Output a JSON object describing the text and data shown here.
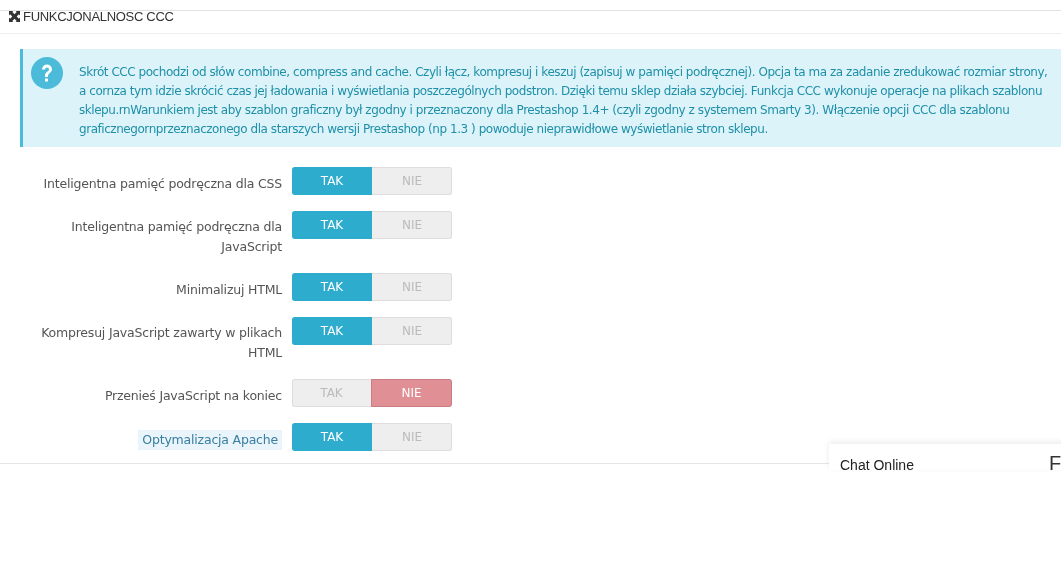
{
  "panel": {
    "title": "FUNKCJONALNOSC CCC"
  },
  "alert": {
    "text": "Skrót CCC pochodzi od słów combine, compress and cache. Czyli łącz, kompresuj i keszuj (zapisuj w pamięci podręcznej). Opcja ta ma za zadanie zredukować rozmiar strony, a cornza tym idzie skrócić czas jej ładowania i wyświetlania poszczególnych podstron. Dzięki temu sklep działa szybciej. Funkcja CCC wykonuje operacje na plikach szablonu sklepu.rnWarunkiem jest aby szablon graficzny był zgodny i przeznaczony dla Prestashop 1.4+ (czyli zgodny z systemem Smarty 3). Włączenie opcji CCC dla szablonu graficznegornprzeznaczonego dla starszych wersji Prestashop (np 1.3 ) powoduje nieprawidłowe wyświetlanie stron sklepu."
  },
  "options": [
    {
      "label": "Inteligentna pamięć podręczna dla CSS",
      "highlighted": false,
      "choices": [
        {
          "label": "TAK",
          "kind": "yes",
          "selected": true
        },
        {
          "label": "NIE",
          "kind": "no",
          "selected": false
        }
      ]
    },
    {
      "label": "Inteligentna pamięć podręczna dla JavaScript",
      "highlighted": false,
      "choices": [
        {
          "label": "TAK",
          "kind": "yes",
          "selected": true
        },
        {
          "label": "NIE",
          "kind": "no",
          "selected": false
        }
      ]
    },
    {
      "label": "Minimalizuj HTML",
      "highlighted": false,
      "choices": [
        {
          "label": "TAK",
          "kind": "yes",
          "selected": true
        },
        {
          "label": "NIE",
          "kind": "no",
          "selected": false
        }
      ]
    },
    {
      "label": "Kompresuj JavaScript zawarty w plikach HTML",
      "highlighted": false,
      "choices": [
        {
          "label": "TAK",
          "kind": "yes",
          "selected": true
        },
        {
          "label": "NIE",
          "kind": "no",
          "selected": false
        }
      ]
    },
    {
      "label": "Przenieś JavaScript na koniec",
      "highlighted": false,
      "choices": [
        {
          "label": "TAK",
          "kind": "yes",
          "selected": false
        },
        {
          "label": "NIE",
          "kind": "no",
          "selected": true
        }
      ]
    },
    {
      "label": "Optymalizacja Apache",
      "highlighted": true,
      "choices": [
        {
          "label": "TAK",
          "kind": "yes",
          "selected": true
        },
        {
          "label": "NIE",
          "kind": "no",
          "selected": false
        }
      ]
    }
  ],
  "chat_widget": {
    "title": "Chat Online",
    "side_text": "F"
  }
}
